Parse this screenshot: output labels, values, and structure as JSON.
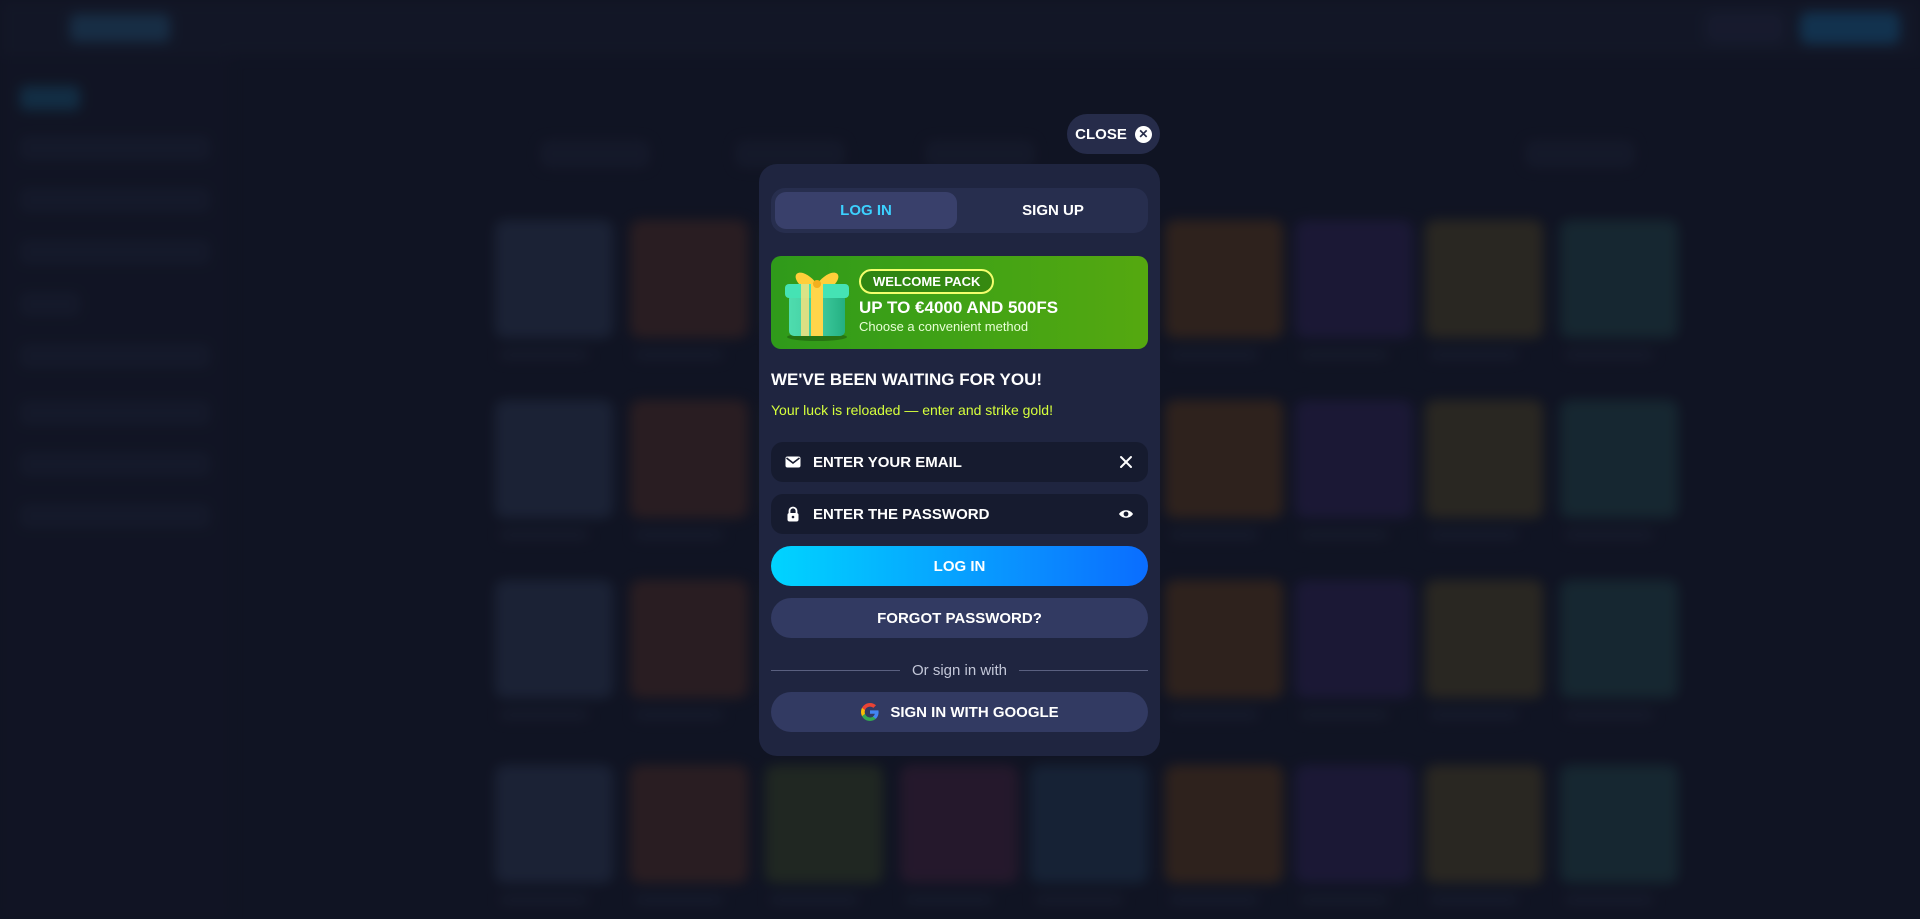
{
  "close": {
    "label": "CLOSE"
  },
  "tabs": [
    {
      "label": "LOG IN",
      "active": true
    },
    {
      "label": "SIGN UP",
      "active": false
    }
  ],
  "promo": {
    "badge": "WELCOME PACK",
    "title": "UP TO €4000 AND 500FS",
    "subtitle": "Choose a convenient method"
  },
  "form": {
    "heading": "WE'VE BEEN WAITING FOR YOU!",
    "subheading": "Your luck is reloaded — enter and strike gold!",
    "email_placeholder": "ENTER YOUR EMAIL",
    "password_placeholder": "ENTER THE PASSWORD",
    "login_label": "LOG IN",
    "forgot_label": "FORGOT PASSWORD?",
    "divider_text": "Or sign in with",
    "google_label": "SIGN IN WITH GOOGLE"
  },
  "colors": {
    "accent_tab": "#3cd1ff",
    "promo_green": "#43a315",
    "subheading": "#d6ff3c",
    "login_gradient_start": "#00d4ff",
    "login_gradient_end": "#0a6dff"
  },
  "icons": {
    "close": "close-circle-icon",
    "email": "envelope-icon",
    "clear": "x-icon",
    "password": "lock-icon",
    "visibility": "eye-icon",
    "google": "google-logo-icon",
    "gift": "gift-box-icon"
  }
}
